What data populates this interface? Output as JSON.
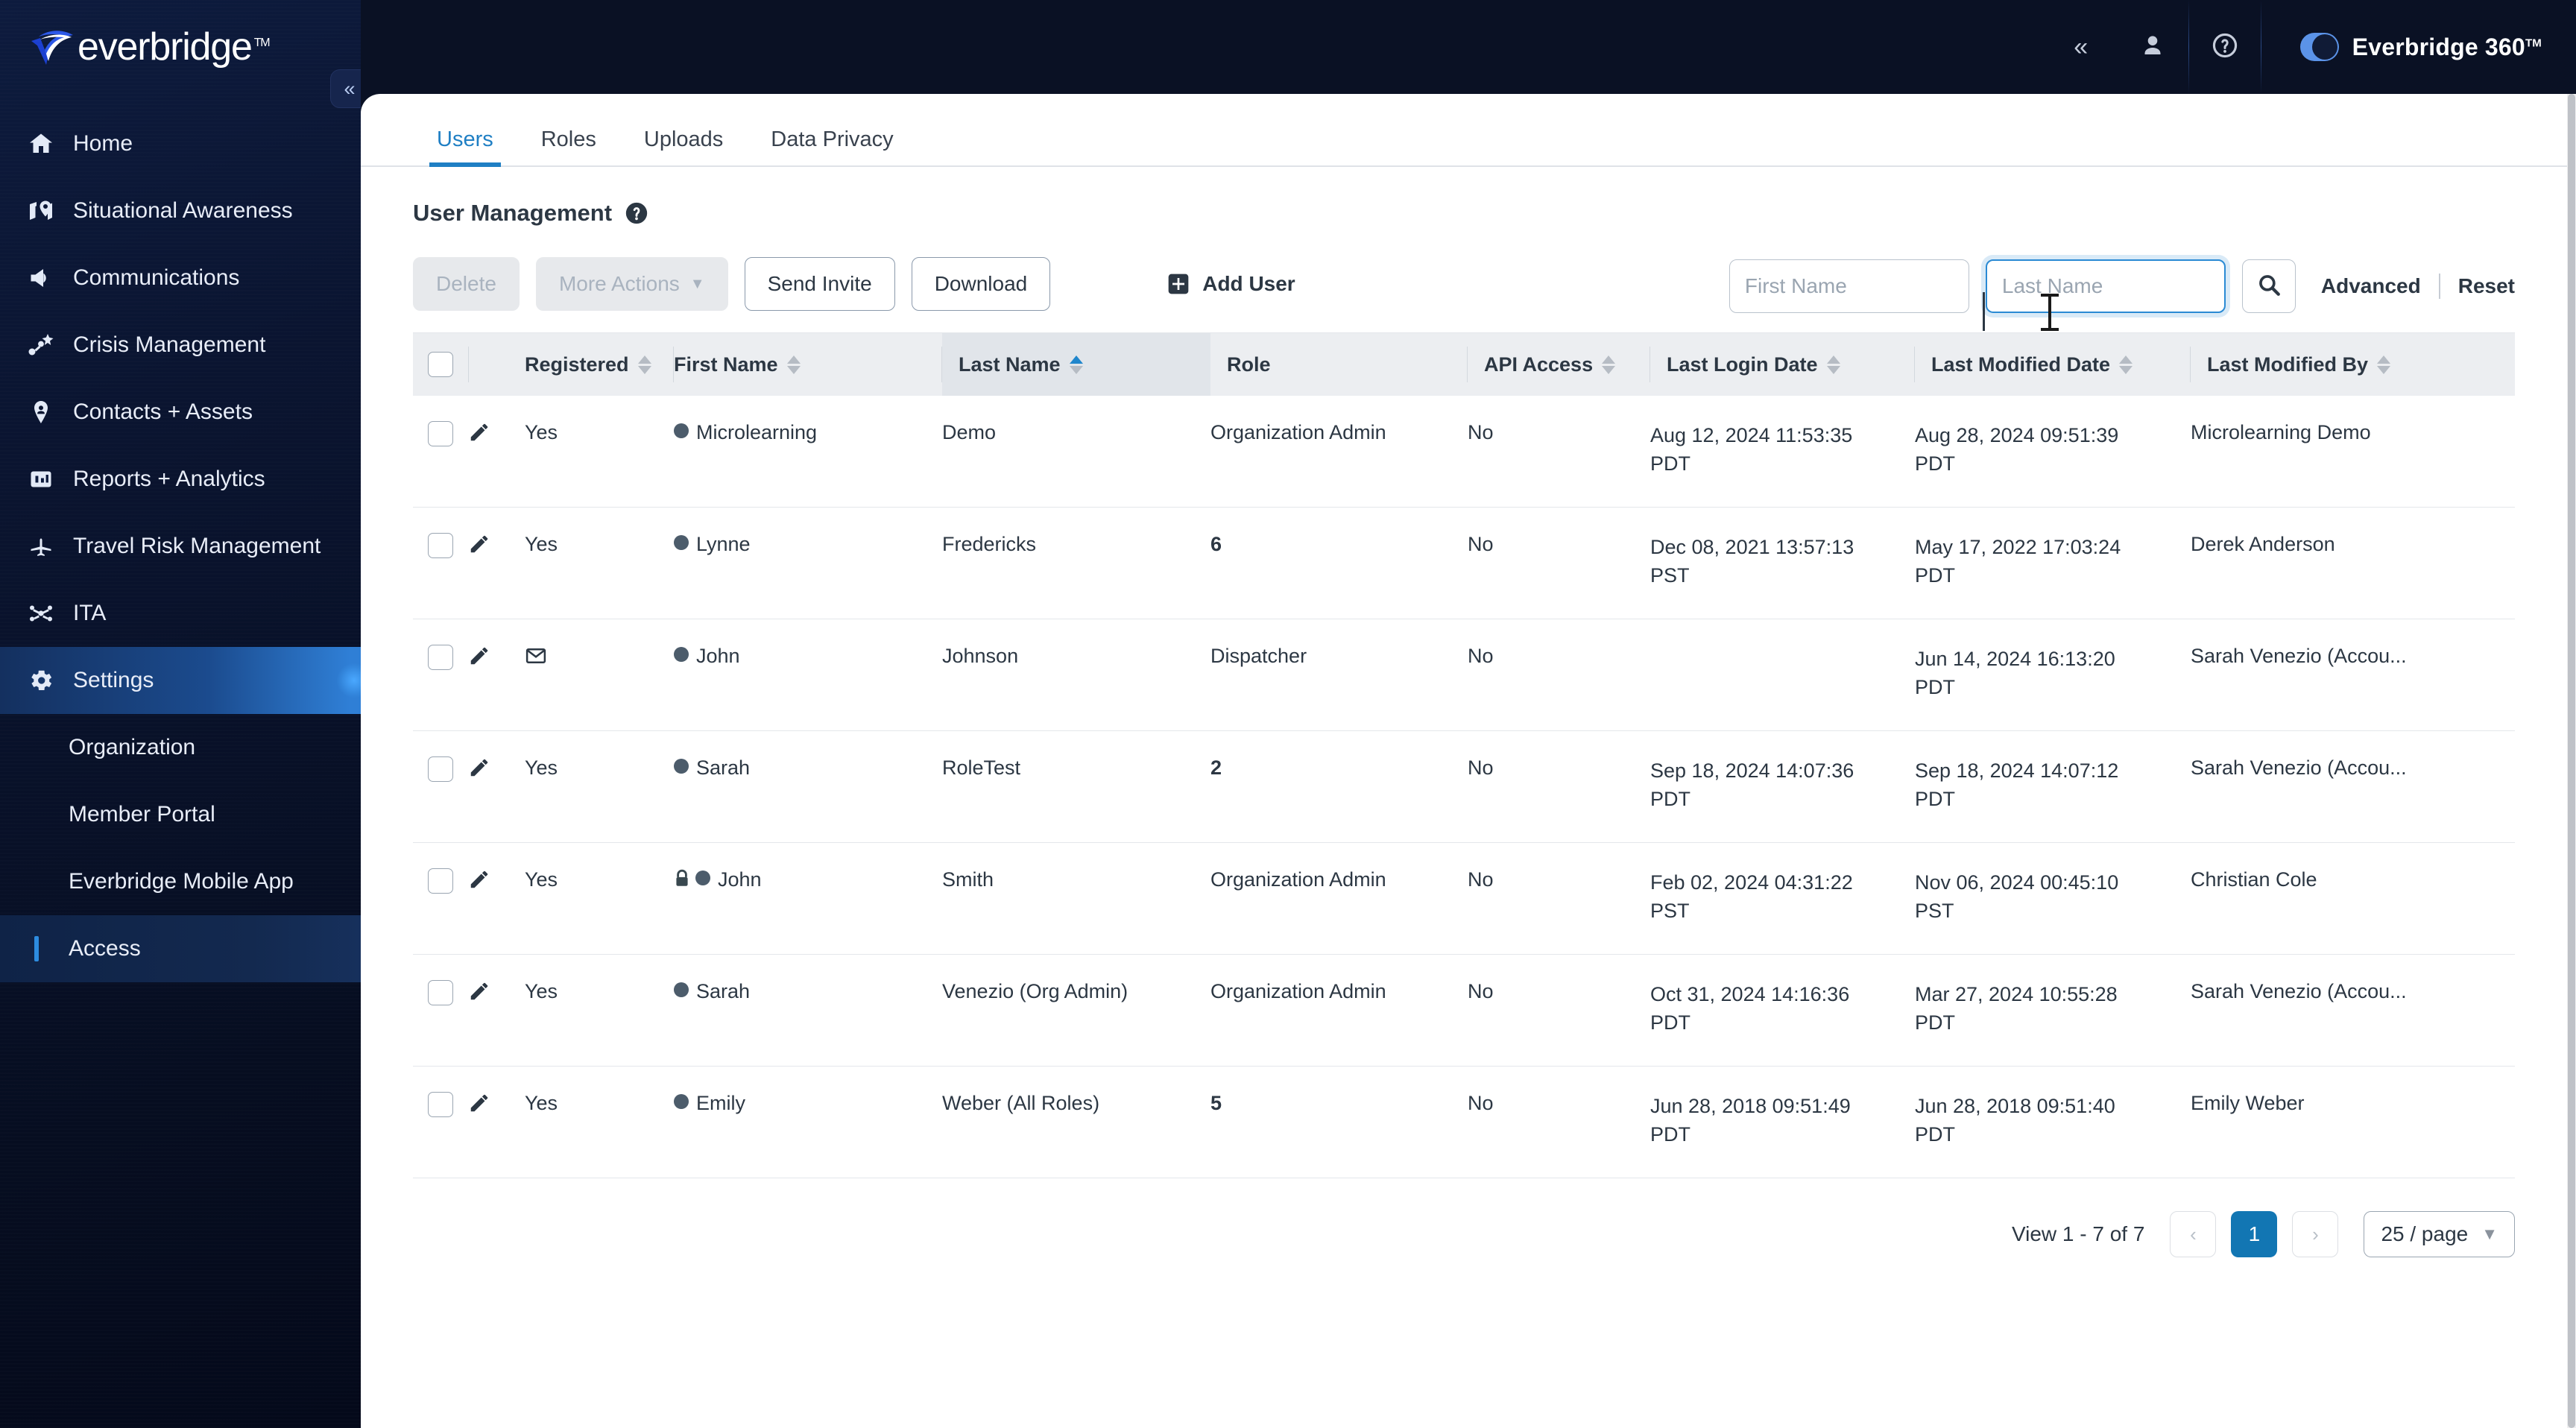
{
  "brand": {
    "logo_text": "everbridge",
    "logo_tm": "TM"
  },
  "topbar": {
    "collapse_icon": "chevron-double-left-icon",
    "user_icon": "user-icon",
    "help_icon": "help-circle-icon",
    "product_label": "Everbridge 360",
    "product_tm": "TM",
    "toggle_state": "on",
    "accent_color": "#5b93e8"
  },
  "sidebar": {
    "items": [
      {
        "label": "Home",
        "icon": "home-icon"
      },
      {
        "label": "Situational Awareness",
        "icon": "map-pin-icon"
      },
      {
        "label": "Communications",
        "icon": "megaphone-icon"
      },
      {
        "label": "Crisis Management",
        "icon": "crisis-node-icon"
      },
      {
        "label": "Contacts + Assets",
        "icon": "location-person-icon"
      },
      {
        "label": "Reports + Analytics",
        "icon": "bar-chart-icon"
      },
      {
        "label": "Travel Risk Management",
        "icon": "airplane-icon"
      },
      {
        "label": "ITA",
        "icon": "network-icon"
      },
      {
        "label": "Settings",
        "icon": "gear-icon"
      }
    ],
    "subitems": [
      {
        "label": "Organization"
      },
      {
        "label": "Member Portal"
      },
      {
        "label": "Everbridge Mobile App"
      },
      {
        "label": "Access"
      }
    ],
    "active_parent": "Settings",
    "selected_subitem": "Access"
  },
  "tabs": [
    {
      "label": "Users",
      "active": true
    },
    {
      "label": "Roles",
      "active": false
    },
    {
      "label": "Uploads",
      "active": false
    },
    {
      "label": "Data Privacy",
      "active": false
    }
  ],
  "page": {
    "title": "User Management",
    "help_icon": "help-circle-icon"
  },
  "toolbar": {
    "delete_label": "Delete",
    "more_actions_label": "More Actions",
    "more_actions_caret": "chevron-down-icon",
    "send_invite_label": "Send Invite",
    "download_label": "Download",
    "add_user_label": "Add User",
    "add_user_icon": "plus-square-icon"
  },
  "search": {
    "first_name_placeholder": "First Name",
    "first_name_value": "",
    "last_name_placeholder": "Last Name",
    "last_name_value": "",
    "search_icon": "search-icon",
    "advanced_label": "Advanced",
    "reset_label": "Reset",
    "focused_field": "Last Name"
  },
  "table": {
    "columns": [
      {
        "label": "Registered",
        "sortable": true,
        "sort": "none"
      },
      {
        "label": "First Name",
        "sortable": true,
        "sort": "none"
      },
      {
        "label": "Last Name",
        "sortable": true,
        "sort": "asc"
      },
      {
        "label": "Role",
        "sortable": false,
        "sort": "none"
      },
      {
        "label": "API Access",
        "sortable": true,
        "sort": "none"
      },
      {
        "label": "Last Login Date",
        "sortable": true,
        "sort": "none"
      },
      {
        "label": "Last Modified Date",
        "sortable": true,
        "sort": "none"
      },
      {
        "label": "Last Modified By",
        "sortable": true,
        "sort": "none"
      }
    ],
    "rows": [
      {
        "registered": "Yes",
        "row_icon": "pencil-icon",
        "badge": "none",
        "first_name": "Microlearning",
        "last_name": "Demo",
        "role": "Organization Admin",
        "role_is_number": false,
        "api_access": "No",
        "last_login": "Aug 12, 2024 11:53:35",
        "last_login_tz": "PDT",
        "last_modified": "Aug 28, 2024 09:51:39",
        "last_modified_tz": "PDT",
        "last_modified_by": "Microlearning Demo"
      },
      {
        "registered": "Yes",
        "row_icon": "pencil-icon",
        "badge": "none",
        "first_name": "Lynne",
        "last_name": "Fredericks",
        "role": "6",
        "role_is_number": true,
        "api_access": "No",
        "last_login": "Dec 08, 2021 13:57:13",
        "last_login_tz": "PST",
        "last_modified": "May 17, 2022 17:03:24",
        "last_modified_tz": "PDT",
        "last_modified_by": "Derek Anderson"
      },
      {
        "registered": "",
        "row_icon": "pencil-icon",
        "badge": "envelope-icon",
        "first_name": "John",
        "last_name": "Johnson",
        "role": "Dispatcher",
        "role_is_number": false,
        "api_access": "No",
        "last_login": "",
        "last_login_tz": "",
        "last_modified": "Jun 14, 2024 16:13:20",
        "last_modified_tz": "PDT",
        "last_modified_by": "Sarah Venezio (Accou..."
      },
      {
        "registered": "Yes",
        "row_icon": "pencil-icon",
        "badge": "none",
        "first_name": "Sarah",
        "last_name": "RoleTest",
        "role": "2",
        "role_is_number": true,
        "api_access": "No",
        "last_login": "Sep 18, 2024 14:07:36",
        "last_login_tz": "PDT",
        "last_modified": "Sep 18, 2024 14:07:12",
        "last_modified_tz": "PDT",
        "last_modified_by": "Sarah Venezio (Accou..."
      },
      {
        "registered": "Yes",
        "row_icon": "pencil-icon",
        "badge": "none",
        "first_name": "John",
        "first_name_lock": true,
        "last_name": "Smith",
        "role": "Organization Admin",
        "role_is_number": false,
        "api_access": "No",
        "last_login": "Feb 02, 2024 04:31:22",
        "last_login_tz": "PST",
        "last_modified": "Nov 06, 2024 00:45:10",
        "last_modified_tz": "PST",
        "last_modified_by": "Christian Cole"
      },
      {
        "registered": "Yes",
        "row_icon": "pencil-icon",
        "badge": "none",
        "first_name": "Sarah",
        "last_name": "Venezio (Org Admin)",
        "role": "Organization Admin",
        "role_is_number": false,
        "api_access": "No",
        "last_login": "Oct 31, 2024 14:16:36",
        "last_login_tz": "PDT",
        "last_modified": "Mar 27, 2024 10:55:28",
        "last_modified_tz": "PDT",
        "last_modified_by": "Sarah Venezio (Accou..."
      },
      {
        "registered": "Yes",
        "row_icon": "pencil-icon",
        "badge": "none",
        "first_name": "Emily",
        "last_name": "Weber (All Roles)",
        "role": "5",
        "role_is_number": true,
        "api_access": "No",
        "last_login": "Jun 28, 2018 09:51:49",
        "last_login_tz": "PDT",
        "last_modified": "Jun 28, 2018 09:51:40",
        "last_modified_tz": "PDT",
        "last_modified_by": "Emily Weber"
      }
    ]
  },
  "pagination": {
    "view_label": "View 1 - 7 of 7",
    "prev_icon": "chevron-left-icon",
    "next_icon": "chevron-right-icon",
    "current_page": "1",
    "per_page_label": "25 / page",
    "per_page_caret": "chevron-down-icon",
    "active_color": "#1276b3"
  }
}
